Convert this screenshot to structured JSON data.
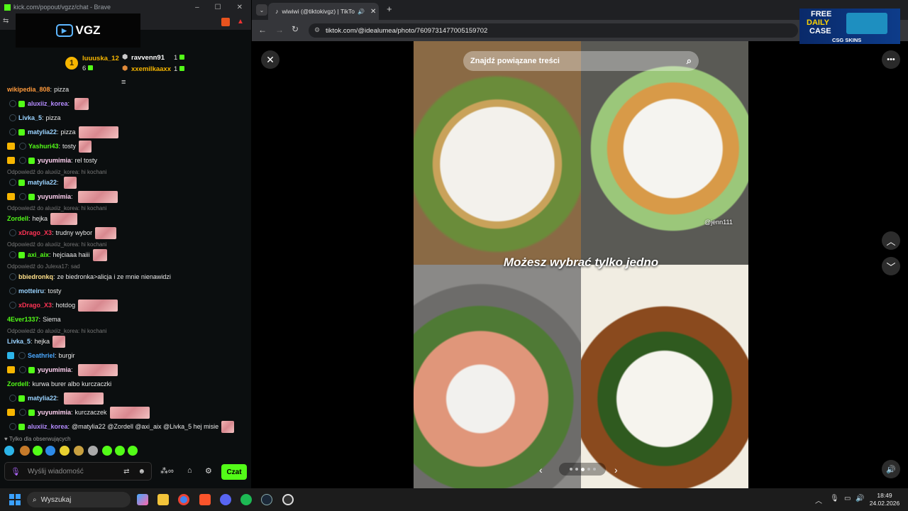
{
  "kick_window": {
    "title": "kick.com/popout/vgzz/chat - Brave",
    "channel_logo": "VGZ",
    "podium": {
      "first": {
        "rank": "1",
        "user": "luuuska_12",
        "count": "6"
      },
      "second": {
        "user": "ravvenn91",
        "count": "1"
      },
      "third": {
        "user": "xxemilkaaxx",
        "count": "1"
      }
    }
  },
  "chat": {
    "messages": [
      {
        "kind": "msg",
        "badges": [],
        "user": "wikipedia_808",
        "color": "#ff9a3c",
        "text": "pizza",
        "emote": false
      },
      {
        "kind": "msg",
        "badges": [
          "circ",
          "sub"
        ],
        "user": "aluxiiz_korea",
        "color": "#b58cff",
        "text": "",
        "emote": true,
        "emote_w": 20
      },
      {
        "kind": "msg",
        "badges": [
          "circ"
        ],
        "user": "Livka_5",
        "color": "#9ad3ff",
        "text": "pizza",
        "emote": false
      },
      {
        "kind": "msg",
        "badges": [
          "circ",
          "sub"
        ],
        "user": "matylia22",
        "color": "#9ad3ff",
        "text": "pizza",
        "emote": true,
        "emote_w": 56
      },
      {
        "kind": "msg",
        "badges": [
          "crown",
          "circ"
        ],
        "user": "Yashuri43",
        "color": "#53fc18",
        "text": "tosty",
        "emote": true,
        "emote_w": 18
      },
      {
        "kind": "msg",
        "badges": [
          "crown",
          "circ",
          "sub"
        ],
        "user": "yuyumimia",
        "color": "#ffd0f0",
        "text": "rel tosty",
        "emote": false
      },
      {
        "kind": "reply",
        "text": "Odpowiedź do aluxiiz_korea: hi kochani"
      },
      {
        "kind": "msg",
        "badges": [
          "circ",
          "sub"
        ],
        "user": "matylia22",
        "color": "#9ad3ff",
        "text": "",
        "emote": true,
        "emote_w": 18
      },
      {
        "kind": "msg",
        "badges": [
          "crown",
          "circ",
          "sub"
        ],
        "user": "yuyumimia",
        "color": "#ffd0f0",
        "text": "",
        "emote": true,
        "emote_w": 56
      },
      {
        "kind": "reply",
        "text": "Odpowiedź do aluxiiz_korea: hi kochani"
      },
      {
        "kind": "msg",
        "badges": [],
        "user": "Zordell",
        "color": "#53fc18",
        "text": "hejka",
        "emote": true,
        "emote_w": 38
      },
      {
        "kind": "msg",
        "badges": [
          "circ"
        ],
        "user": "xDrago_X3",
        "color": "#ff3355",
        "text": "trudny wybor",
        "emote": true,
        "emote_w": 30
      },
      {
        "kind": "reply",
        "text": "Odpowiedź do aluxiiz_korea: hi kochani"
      },
      {
        "kind": "msg",
        "badges": [
          "circ",
          "sub"
        ],
        "user": "axi_aix",
        "color": "#53fc18",
        "text": "hejciaaa haiii",
        "emote": true,
        "emote_w": 20
      },
      {
        "kind": "reply",
        "text": "Odpowiedź do Julexa17: sad"
      },
      {
        "kind": "msg",
        "badges": [
          "circ"
        ],
        "user": "bbiedronkq",
        "color": "#ffe08a",
        "text": "ze biedronka>alicja i ze mnie nienawidzi",
        "emote": false
      },
      {
        "kind": "msg",
        "badges": [
          "circ"
        ],
        "user": "motteiru",
        "color": "#9ad3ff",
        "text": "tosty",
        "emote": false
      },
      {
        "kind": "msg",
        "badges": [
          "circ"
        ],
        "user": "xDrago_X3",
        "color": "#ff3355",
        "text": "hotdog",
        "emote": true,
        "emote_w": 56
      },
      {
        "kind": "msg",
        "badges": [],
        "user": "4Ever1337",
        "color": "#53fc18",
        "text": "Siema",
        "emote": false
      },
      {
        "kind": "reply",
        "text": "Odpowiedź do aluxiiz_korea: hi kochani"
      },
      {
        "kind": "msg",
        "badges": [],
        "user": "Livka_5",
        "color": "#9ad3ff",
        "text": "hejka",
        "emote": true,
        "emote_w": 18
      },
      {
        "kind": "msg",
        "badges": [
          "mod",
          "circ"
        ],
        "user": "Seathriel",
        "color": "#4aa8ff",
        "text": "burgir",
        "emote": false
      },
      {
        "kind": "msg",
        "badges": [
          "crown",
          "circ",
          "sub"
        ],
        "user": "yuyumimia",
        "color": "#ffd0f0",
        "text": "",
        "emote": true,
        "emote_w": 56
      },
      {
        "kind": "msg",
        "badges": [],
        "user": "Zordell",
        "color": "#53fc18",
        "text": "kurwa burer albo kurczaczki",
        "emote": false
      },
      {
        "kind": "msg",
        "badges": [
          "circ",
          "sub"
        ],
        "user": "matylia22",
        "color": "#9ad3ff",
        "text": "",
        "emote": true,
        "emote_w": 56
      },
      {
        "kind": "msg",
        "badges": [
          "crown",
          "circ",
          "sub"
        ],
        "user": "yuyumimia",
        "color": "#ffd0f0",
        "text": "kurczaczek",
        "emote": true,
        "emote_w": 56
      },
      {
        "kind": "msg",
        "badges": [
          "circ",
          "sub"
        ],
        "user": "aluxiiz_korea",
        "color": "#b58cff",
        "text": "@matylia22 @Zordell @axi_aix @Livka_5 hej misie",
        "emote": true,
        "emote_w": 18
      }
    ],
    "followers_only": "Tylko dla obserwujących",
    "input_placeholder": "Wyślij wiadomość",
    "send_label": "Czat"
  },
  "browser": {
    "tab_title": "wiwiwi (@tiktokivgz) | TikTo",
    "url": "tiktok.com/@idealumea/photo/7609731477005159702",
    "ad": {
      "line1": "FREE",
      "line2": "DAILY",
      "line3": "CASE",
      "brand": "CSG SKINS"
    },
    "search_placeholder": "Znajdź powiązane treści",
    "overlay_text": "Możesz wybrać tylko jedno",
    "watermark": "@jenn111"
  },
  "taskbar": {
    "search": "Wyszukaj",
    "time": "18:49",
    "date": "24.02.2026"
  }
}
